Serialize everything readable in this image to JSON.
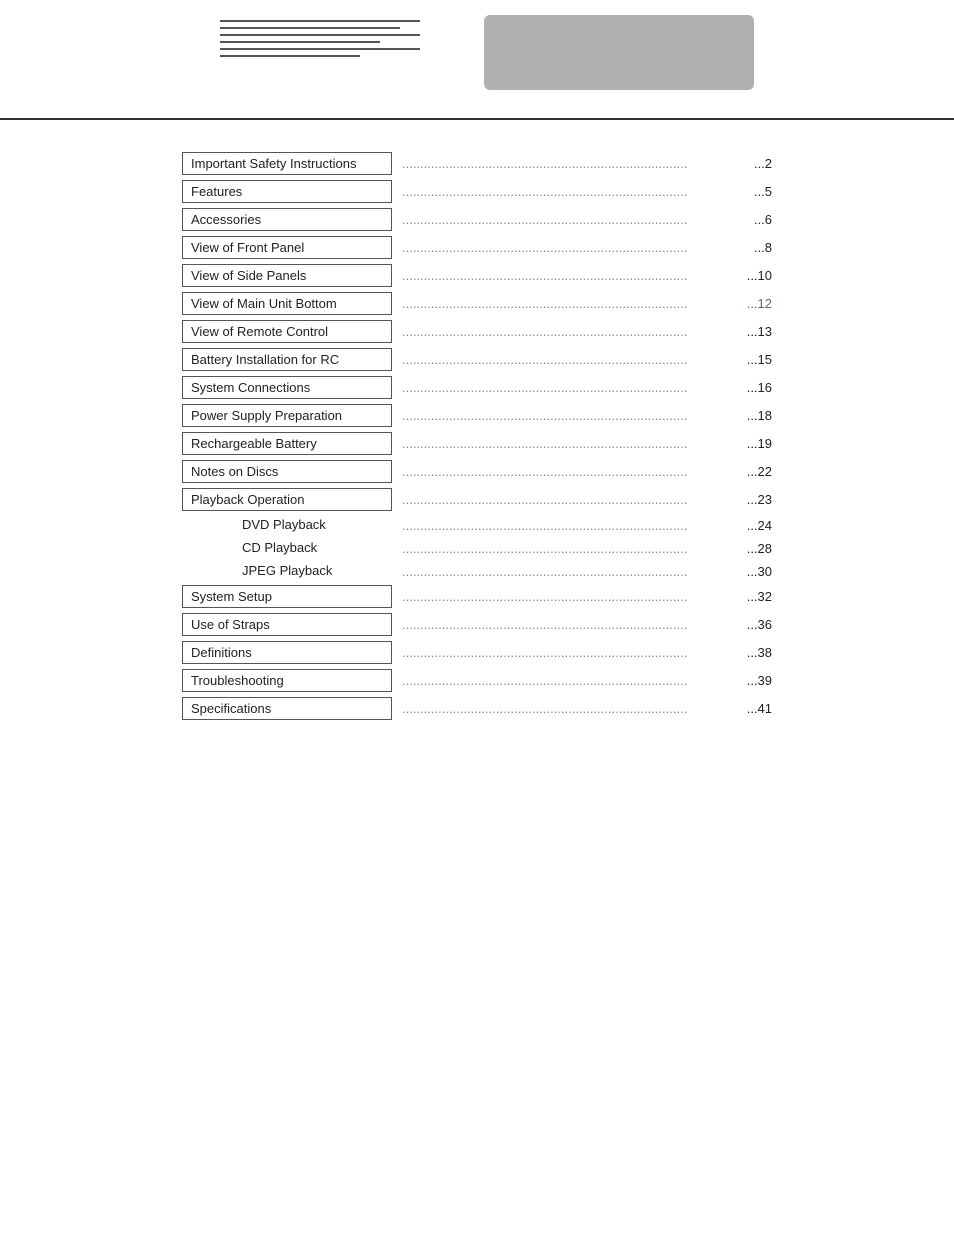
{
  "header": {
    "grayBox": true
  },
  "toc": {
    "items": [
      {
        "label": "Important Safety Instructions",
        "page": "2",
        "indent": false,
        "boxed": true,
        "pageGreen": false
      },
      {
        "label": "Features",
        "page": "5",
        "indent": false,
        "boxed": true,
        "pageGreen": false
      },
      {
        "label": "Accessories",
        "page": "6",
        "indent": false,
        "boxed": true,
        "pageGreen": false
      },
      {
        "label": "View of Front Panel",
        "page": "8",
        "indent": false,
        "boxed": true,
        "pageGreen": false
      },
      {
        "label": "View of Side Panels",
        "page": "10",
        "indent": false,
        "boxed": true,
        "pageGreen": false
      },
      {
        "label": "View of Main Unit Bottom",
        "page": "12",
        "indent": false,
        "boxed": true,
        "pageGreen": true
      },
      {
        "label": "View of Remote Control",
        "page": "13",
        "indent": false,
        "boxed": true,
        "pageGreen": false
      },
      {
        "label": "Battery Installation for RC",
        "page": "15",
        "indent": false,
        "boxed": true,
        "pageGreen": false
      },
      {
        "label": "System Connections",
        "page": "16",
        "indent": false,
        "boxed": true,
        "pageGreen": false
      },
      {
        "label": "Power Supply Preparation",
        "page": "18",
        "indent": false,
        "boxed": true,
        "pageGreen": false
      },
      {
        "label": "Rechargeable Battery",
        "page": "19",
        "indent": false,
        "boxed": true,
        "pageGreen": false
      },
      {
        "label": "Notes on Discs",
        "page": "22",
        "indent": false,
        "boxed": true,
        "pageGreen": false
      },
      {
        "label": "Playback Operation",
        "page": "23",
        "indent": false,
        "boxed": true,
        "pageGreen": false
      },
      {
        "label": "DVD Playback",
        "page": "24",
        "indent": true,
        "boxed": false,
        "pageGreen": false
      },
      {
        "label": "CD Playback",
        "page": "28",
        "indent": true,
        "boxed": false,
        "pageGreen": false
      },
      {
        "label": "JPEG Playback",
        "page": "30",
        "indent": true,
        "boxed": false,
        "pageGreen": false
      },
      {
        "label": "System Setup",
        "page": "32",
        "indent": false,
        "boxed": true,
        "pageGreen": false
      },
      {
        "label": "Use of Straps",
        "page": "36",
        "indent": false,
        "boxed": true,
        "pageGreen": false
      },
      {
        "label": "Definitions",
        "page": "38",
        "indent": false,
        "boxed": true,
        "pageGreen": false
      },
      {
        "label": "Troubleshooting",
        "page": "39",
        "indent": false,
        "boxed": true,
        "pageGreen": false
      },
      {
        "label": "Specifications",
        "page": "41",
        "indent": false,
        "boxed": true,
        "pageGreen": false
      }
    ]
  }
}
